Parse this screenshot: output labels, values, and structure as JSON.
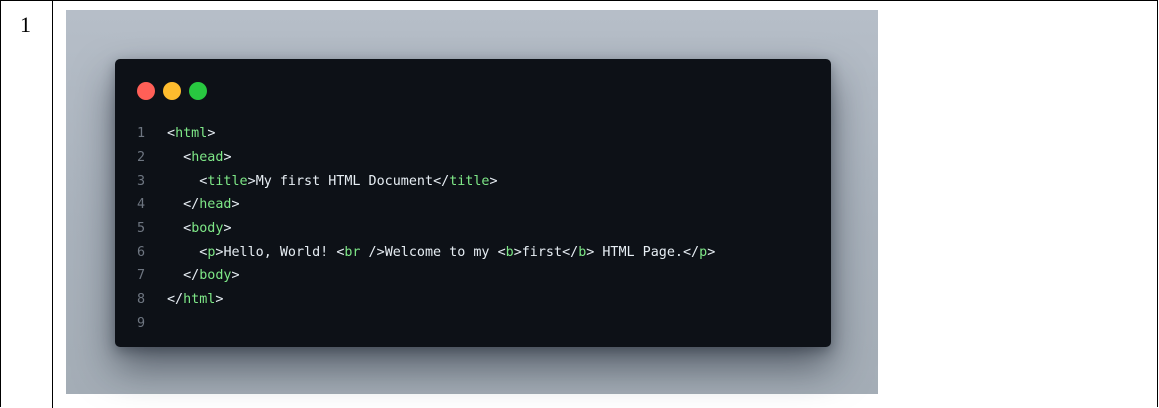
{
  "row_number": "1",
  "window": {
    "traffic_lights": [
      {
        "name": "close",
        "color": "#ff5f57"
      },
      {
        "name": "minimize",
        "color": "#febc2e"
      },
      {
        "name": "maximize",
        "color": "#28c840"
      }
    ]
  },
  "colors": {
    "background_panel": "#abb4be",
    "editor_background": "#0d1117",
    "tag_color": "#7ee787",
    "text_color": "#e6edf3",
    "line_number_color": "#6e7681"
  },
  "code_lines": [
    {
      "number": "1",
      "indent": "",
      "tokens": [
        {
          "t": "p",
          "v": "<"
        },
        {
          "t": "tag",
          "v": "html"
        },
        {
          "t": "p",
          "v": ">"
        }
      ]
    },
    {
      "number": "2",
      "indent": "  ",
      "tokens": [
        {
          "t": "p",
          "v": "<"
        },
        {
          "t": "tag",
          "v": "head"
        },
        {
          "t": "p",
          "v": ">"
        }
      ]
    },
    {
      "number": "3",
      "indent": "    ",
      "tokens": [
        {
          "t": "p",
          "v": "<"
        },
        {
          "t": "tag",
          "v": "title"
        },
        {
          "t": "p",
          "v": ">"
        },
        {
          "t": "text",
          "v": "My first HTML Document"
        },
        {
          "t": "p",
          "v": "</"
        },
        {
          "t": "tag",
          "v": "title"
        },
        {
          "t": "p",
          "v": ">"
        }
      ]
    },
    {
      "number": "4",
      "indent": "  ",
      "tokens": [
        {
          "t": "p",
          "v": "</"
        },
        {
          "t": "tag",
          "v": "head"
        },
        {
          "t": "p",
          "v": ">"
        }
      ]
    },
    {
      "number": "5",
      "indent": "  ",
      "tokens": [
        {
          "t": "p",
          "v": "<"
        },
        {
          "t": "tag",
          "v": "body"
        },
        {
          "t": "p",
          "v": ">"
        }
      ]
    },
    {
      "number": "6",
      "indent": "    ",
      "tokens": [
        {
          "t": "p",
          "v": "<"
        },
        {
          "t": "tag",
          "v": "p"
        },
        {
          "t": "p",
          "v": ">"
        },
        {
          "t": "text",
          "v": "Hello, World! "
        },
        {
          "t": "p",
          "v": "<"
        },
        {
          "t": "tag",
          "v": "br"
        },
        {
          "t": "p",
          "v": " />"
        },
        {
          "t": "text",
          "v": "Welcome to my "
        },
        {
          "t": "p",
          "v": "<"
        },
        {
          "t": "tag",
          "v": "b"
        },
        {
          "t": "p",
          "v": ">"
        },
        {
          "t": "text",
          "v": "first"
        },
        {
          "t": "p",
          "v": "</"
        },
        {
          "t": "tag",
          "v": "b"
        },
        {
          "t": "p",
          "v": ">"
        },
        {
          "t": "text",
          "v": " HTML Page."
        },
        {
          "t": "p",
          "v": "</"
        },
        {
          "t": "tag",
          "v": "p"
        },
        {
          "t": "p",
          "v": ">"
        }
      ]
    },
    {
      "number": "7",
      "indent": "  ",
      "tokens": [
        {
          "t": "p",
          "v": "</"
        },
        {
          "t": "tag",
          "v": "body"
        },
        {
          "t": "p",
          "v": ">"
        }
      ]
    },
    {
      "number": "8",
      "indent": "",
      "tokens": [
        {
          "t": "p",
          "v": "</"
        },
        {
          "t": "tag",
          "v": "html"
        },
        {
          "t": "p",
          "v": ">"
        }
      ]
    },
    {
      "number": "9",
      "indent": "",
      "tokens": []
    }
  ]
}
